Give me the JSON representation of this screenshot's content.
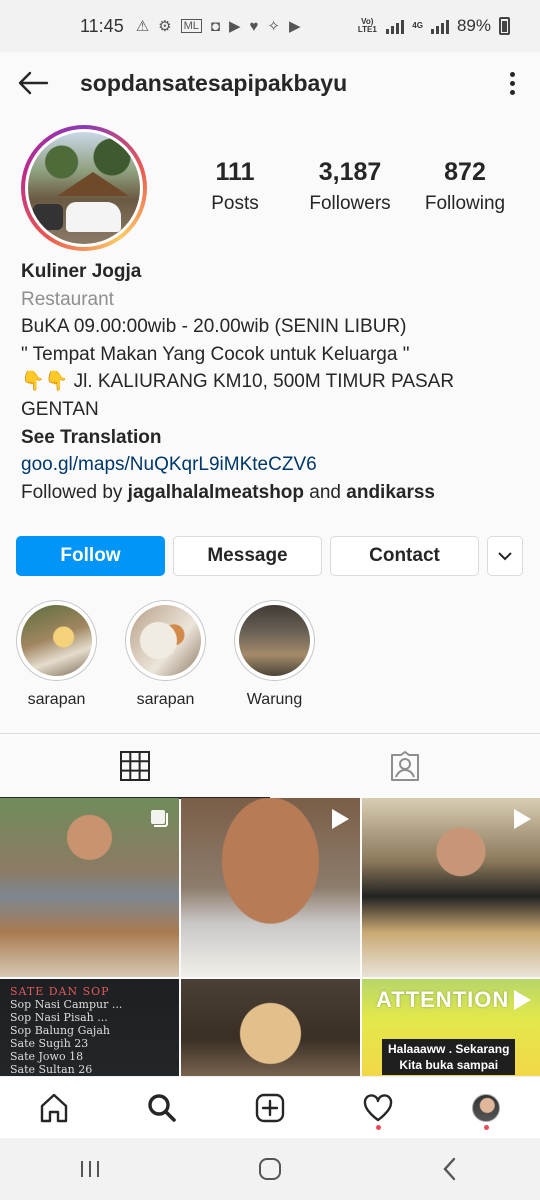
{
  "status_bar": {
    "time": "11:45",
    "network_label": "Vo) LTE1",
    "network_type": "4G",
    "battery": "89%"
  },
  "header": {
    "username": "sopdansatesapipakbayu",
    "back_icon": "arrow-left-icon",
    "more_icon": "more-vertical-icon"
  },
  "stats": [
    {
      "value": "111",
      "label": "Posts"
    },
    {
      "value": "3,187",
      "label": "Followers"
    },
    {
      "value": "872",
      "label": "Following"
    }
  ],
  "bio": {
    "name": "Kuliner Jogja",
    "category": "Restaurant",
    "line1": "BuKA 09.00:00wib - 20.00wib (SENIN LIBUR)",
    "line2": "\" Tempat Makan Yang Cocok untuk Keluarga \"",
    "line3_emoji": "👇👇",
    "line3": " Jl. KALIURANG KM10, 500M TIMUR PASAR",
    "line4": "GENTAN",
    "see_translation": "See Translation",
    "link": "goo.gl/maps/NuQKqrL9iMKteCZV6",
    "followed_by_prefix": "Followed by ",
    "followed_by_user1": "jagalhalalmeatshop",
    "followed_by_and": " and ",
    "followed_by_user2": "andikarss"
  },
  "actions": {
    "follow": "Follow",
    "message": "Message",
    "contact": "Contact"
  },
  "highlights": [
    {
      "label": "sarapan"
    },
    {
      "label": "sarapan"
    },
    {
      "label": "Warung"
    }
  ],
  "tabs": [
    {
      "icon": "grid-icon",
      "active": true
    },
    {
      "icon": "tagged-user-icon",
      "active": false
    }
  ],
  "posts": {
    "menu_title": "SATE DAN SOP",
    "menu_lines": [
      "Sop Nasi Campur ...",
      "Sop Nasi Pisah ...",
      "Sop Balung Gajah",
      "Sate Sugih    23",
      "Sate Jowo     18",
      "Sate Sultan   26"
    ],
    "attention_title": "ATTENTION",
    "attention_sub1": "Halaaaww . Sekarang",
    "attention_sub2": "Kita buka sampai"
  },
  "bottom_nav": [
    "home-icon",
    "search-icon",
    "add-post-icon",
    "activity-heart-icon",
    "profile-avatar"
  ],
  "system_nav": [
    "recent-apps-icon",
    "home-circle-icon",
    "back-chevron-icon"
  ],
  "colors": {
    "follow_button": "#0095f6",
    "link": "#00376b",
    "notification_dot": "#ed4956"
  }
}
